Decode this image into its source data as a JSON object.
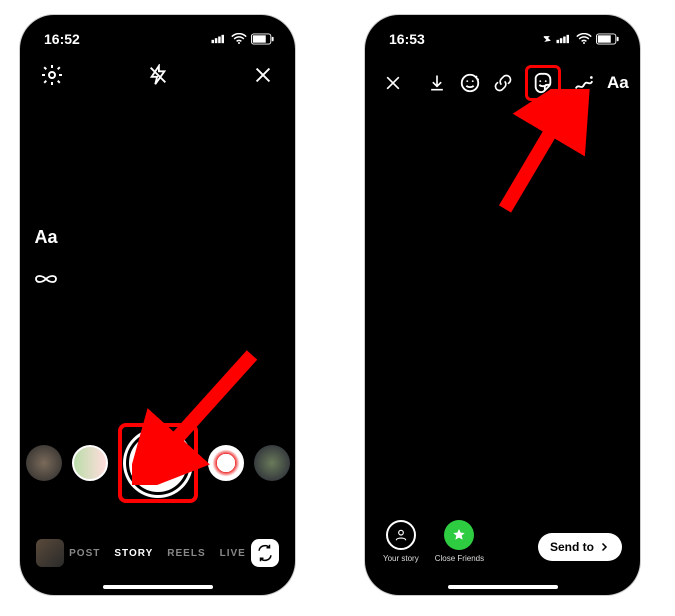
{
  "phone1": {
    "time": "16:52",
    "side": {
      "aa": "Aa"
    },
    "modes": {
      "post": "POST",
      "story": "STORY",
      "reels": "REELS",
      "live": "LIVE"
    }
  },
  "phone2": {
    "time": "16:53",
    "aa": "Aa",
    "targets": {
      "your_story": "Your story",
      "close_friends": "Close Friends"
    },
    "send_to": "Send to"
  }
}
